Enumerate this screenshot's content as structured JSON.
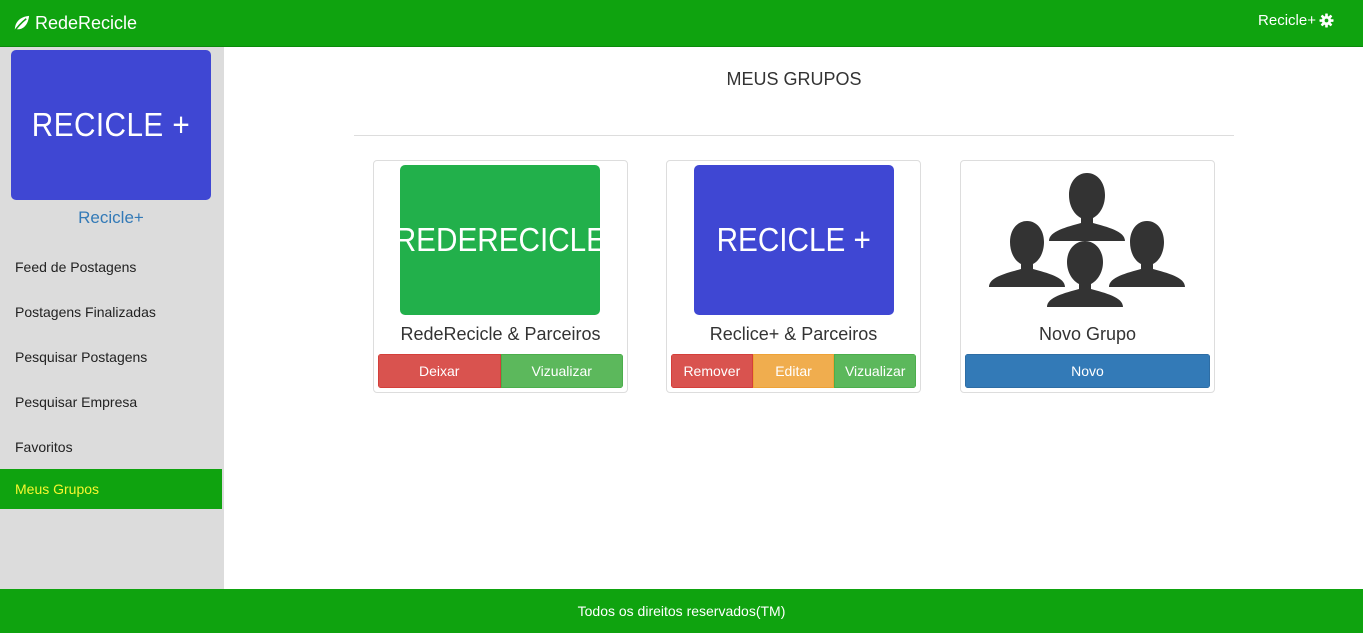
{
  "navbar": {
    "brand": "RedeRecicle",
    "brand_icon": "leaf-icon",
    "user_label": "Recicle+",
    "user_icon": "gear-icon"
  },
  "sidebar": {
    "profile_image_text": "RECICLE +",
    "profile_name": "Recicle+",
    "items": [
      {
        "label": "Feed de Postagens"
      },
      {
        "label": "Postagens Finalizadas"
      },
      {
        "label": "Pesquisar Postagens"
      },
      {
        "label": "Pesquisar Empresa"
      },
      {
        "label": "Favoritos"
      },
      {
        "label": "Meus Grupos",
        "active": true
      }
    ]
  },
  "main": {
    "title": "MEUS GRUPOS",
    "groups": [
      {
        "image_text": "REDERECICLE",
        "image_color": "#22b04b",
        "title": "RedeRecicle & Parceiros",
        "buttons": [
          "Deixar",
          "Vizualizar"
        ]
      },
      {
        "image_text": "RECICLE +",
        "image_color": "#3f47d3",
        "title": "Reclice+ & Parceiros",
        "buttons": [
          "Remover",
          "Editar",
          "Vizualizar"
        ]
      },
      {
        "image_icon": "group-users-icon",
        "title": "Novo Grupo",
        "buttons": [
          "Novo"
        ]
      }
    ]
  },
  "footer": {
    "text": "Todos os direitos reservados(TM)"
  },
  "colors": {
    "brand_green": "#0fa30f",
    "active_text": "#f7f72f",
    "sidebar_bg": "#dcdcdc",
    "link_blue": "#337ab7",
    "danger": "#d9534f",
    "success": "#5cb85c",
    "warning": "#f0ad4e",
    "primary": "#337ab7"
  }
}
